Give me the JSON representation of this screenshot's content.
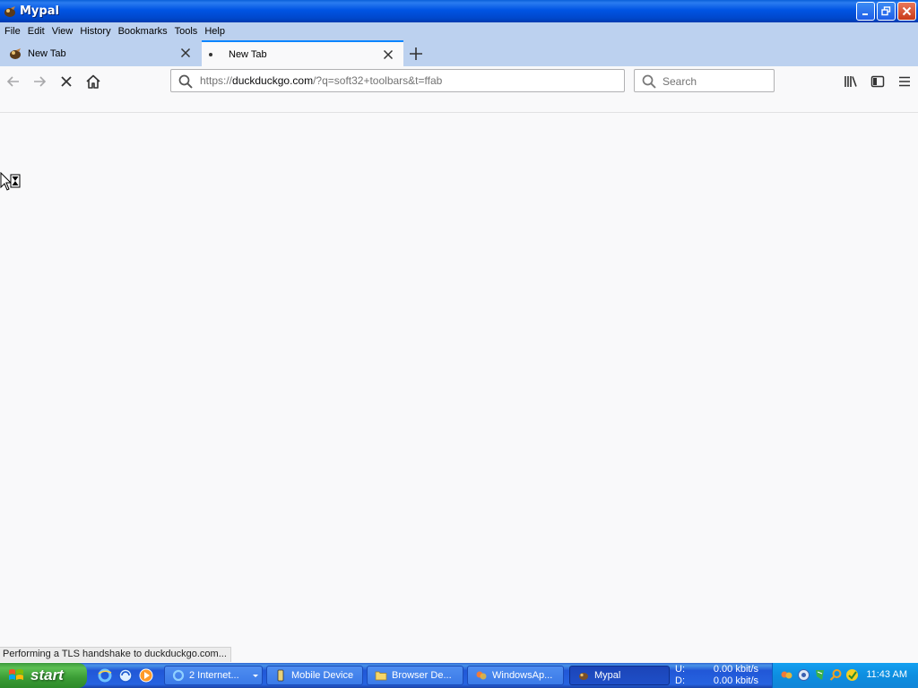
{
  "window": {
    "title": "Mypal",
    "icon": "mypal-app-icon"
  },
  "menubar": {
    "items": [
      "File",
      "Edit",
      "View",
      "History",
      "Bookmarks",
      "Tools",
      "Help"
    ]
  },
  "tabs": [
    {
      "label": "New Tab",
      "active": false
    },
    {
      "label": "New Tab",
      "active": true
    }
  ],
  "navbar": {
    "url_prefix": "https://",
    "url_domain": "duckduckgo.com",
    "url_rest": "/?q=soft32+toolbars&t=ffab",
    "search_placeholder": "Search"
  },
  "status": {
    "text": "Performing a TLS handshake to duckduckgo.com..."
  },
  "taskbar": {
    "start_label": "start",
    "buttons": [
      {
        "label": "2 Internet...",
        "icon": "ie-icon"
      },
      {
        "label": "Mobile Device",
        "icon": "mobile-device-icon"
      },
      {
        "label": "Browser De...",
        "icon": "folder-icon"
      },
      {
        "label": "WindowsAp...",
        "icon": "windows-app-icon"
      },
      {
        "label": "Mypal",
        "icon": "mypal-app-icon"
      }
    ],
    "net_up_label": "U:",
    "net_down_label": "D:",
    "net_up_value": "0.00 kbit/s",
    "net_down_value": "0.00 kbit/s",
    "clock": "11:43 AM"
  }
}
